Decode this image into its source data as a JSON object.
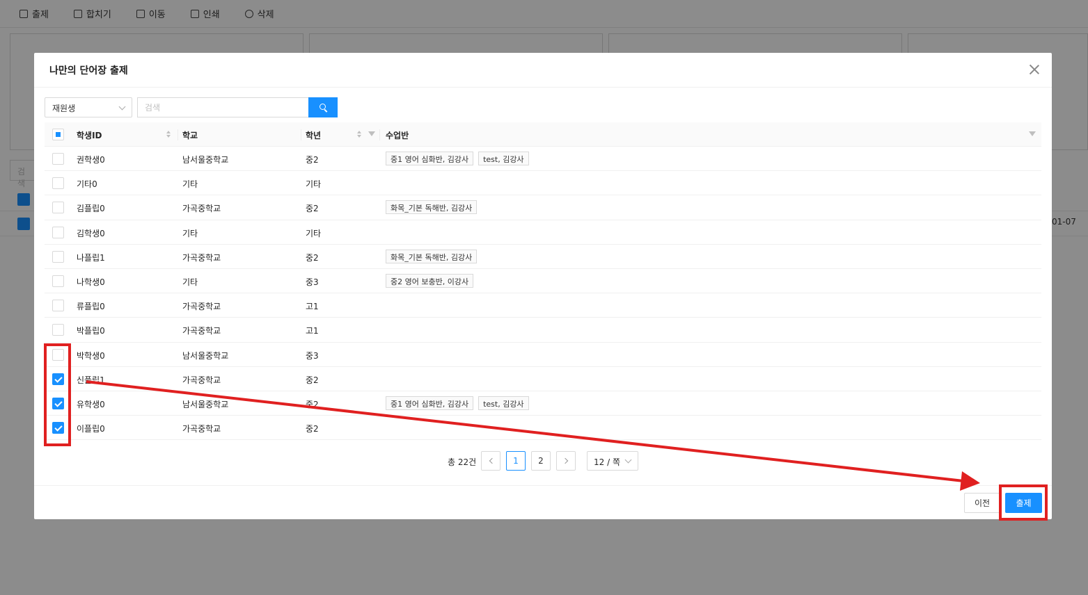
{
  "toolbar": {
    "items": [
      {
        "label": "출제",
        "icon": "file-icon"
      },
      {
        "label": "합치기",
        "icon": "merge-file-icon"
      },
      {
        "label": "이동",
        "icon": "swap-icon"
      },
      {
        "label": "인쇄",
        "icon": "print-icon"
      },
      {
        "label": "삭제",
        "icon": "delete-circle-icon"
      }
    ]
  },
  "background": {
    "search_placeholder": "검색",
    "date_fragment": "01-07"
  },
  "modal": {
    "title": "나만의 단어장 출제",
    "filter": {
      "select_value": "재원생",
      "search_placeholder": "검색"
    },
    "columns": {
      "student_id": "학생ID",
      "school": "학교",
      "grade": "학년",
      "class": "수업반"
    },
    "rows": [
      {
        "id": "권학생0",
        "school": "남서울중학교",
        "grade": "중2",
        "classes": [
          "중1 영어 심화반, 김강사",
          "test, 김강사"
        ],
        "checked": false
      },
      {
        "id": "기타0",
        "school": "기타",
        "grade": "기타",
        "classes": [],
        "checked": false
      },
      {
        "id": "김플립0",
        "school": "가곡중학교",
        "grade": "중2",
        "classes": [
          "화목_기본 독해반, 김강사"
        ],
        "checked": false
      },
      {
        "id": "김학생0",
        "school": "기타",
        "grade": "기타",
        "classes": [],
        "checked": false
      },
      {
        "id": "나플립1",
        "school": "가곡중학교",
        "grade": "중2",
        "classes": [
          "화목_기본 독해반, 김강사"
        ],
        "checked": false
      },
      {
        "id": "나학생0",
        "school": "기타",
        "grade": "중3",
        "classes": [
          "중2 영어 보충반, 이강사"
        ],
        "checked": false
      },
      {
        "id": "류플립0",
        "school": "가곡중학교",
        "grade": "고1",
        "classes": [],
        "checked": false
      },
      {
        "id": "박플립0",
        "school": "가곡중학교",
        "grade": "고1",
        "classes": [],
        "checked": false
      },
      {
        "id": "박학생0",
        "school": "남서울중학교",
        "grade": "중3",
        "classes": [],
        "checked": false
      },
      {
        "id": "신플립1",
        "school": "가곡중학교",
        "grade": "중2",
        "classes": [],
        "checked": true
      },
      {
        "id": "유학생0",
        "school": "남서울중학교",
        "grade": "중2",
        "classes": [
          "중1 영어 심화반, 김강사",
          "test, 김강사"
        ],
        "checked": true
      },
      {
        "id": "이플립0",
        "school": "가곡중학교",
        "grade": "중2",
        "classes": [],
        "checked": true
      }
    ],
    "pagination": {
      "total": "총 22건",
      "pages": [
        "1",
        "2"
      ],
      "current": "1",
      "page_size": "12 / 쪽"
    },
    "footer": {
      "prev_label": "이전",
      "submit_label": "출제"
    }
  },
  "colors": {
    "primary": "#1890ff",
    "annotation": "#e02020"
  }
}
